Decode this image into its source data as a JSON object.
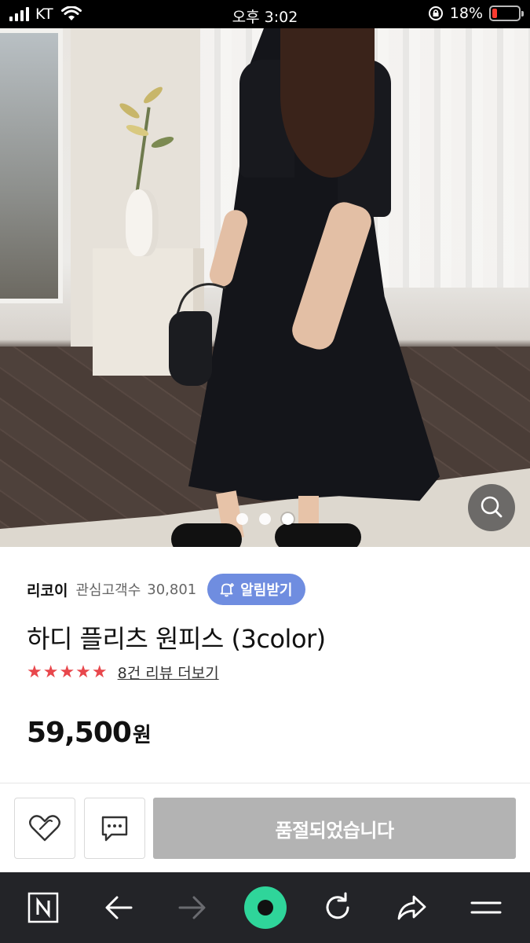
{
  "status_bar": {
    "carrier": "KT",
    "time": "오후 3:02",
    "battery_percent": "18%",
    "battery_level": 0.18,
    "battery_color": "#ff3b30"
  },
  "hero": {
    "image_description_icon": "product-photo",
    "dots": [
      "slide-1",
      "slide-2",
      "slide-3"
    ],
    "active_dot": 2,
    "zoom_icon": "search-icon"
  },
  "store": {
    "name": "리코이",
    "followers_label": "관심고객수",
    "followers_count": "30,801",
    "alert_label": "알림받기",
    "alert_color": "#6f8de0"
  },
  "product": {
    "title": "하디 플리츠 원피스 (3color)",
    "rating_stars": "★★★★★",
    "rating_value": 5,
    "review_link": "8건 리뷰 더보기",
    "price": "59,500",
    "price_unit": "원"
  },
  "actions": {
    "wishlist_icon": "heart-icon",
    "chat_icon": "chat-icon",
    "soldout_label": "품절되었습니다"
  },
  "browser_bar": {
    "icons": [
      "naver-n-icon",
      "back-arrow-icon",
      "forward-arrow-icon",
      "home-circle-icon",
      "refresh-icon",
      "share-icon",
      "menu-icon"
    ],
    "accent_color": "#2fd59a"
  }
}
